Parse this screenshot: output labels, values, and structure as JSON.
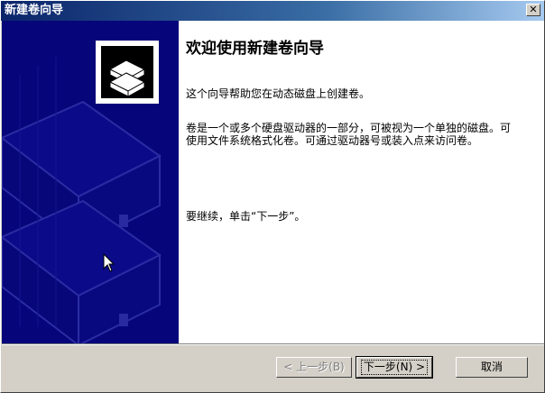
{
  "window": {
    "title": "新建卷向导",
    "close_glyph": "✕"
  },
  "content": {
    "heading": "欢迎使用新建卷向导",
    "paragraph1": "这个向导帮助您在动态磁盘上创建卷。",
    "paragraph2": "卷是一个或多个硬盘驱动器的一部分，可被视为一个单独的磁盘。可使用文件系统格式化卷。可通过驱动器号或装入点来访问卷。",
    "paragraph3": "要继续，单击“下一步”。"
  },
  "buttons": {
    "back": "< 上一步(B)",
    "next": "下一步(N) >",
    "cancel": "取消"
  },
  "colors": {
    "title_bar": "#0a246a",
    "side_panel": "#06067a",
    "face": "#d4d0c8"
  },
  "icons": {
    "wizard_logo": "stacked-disks-icon",
    "cursor": "mouse-pointer-icon"
  }
}
